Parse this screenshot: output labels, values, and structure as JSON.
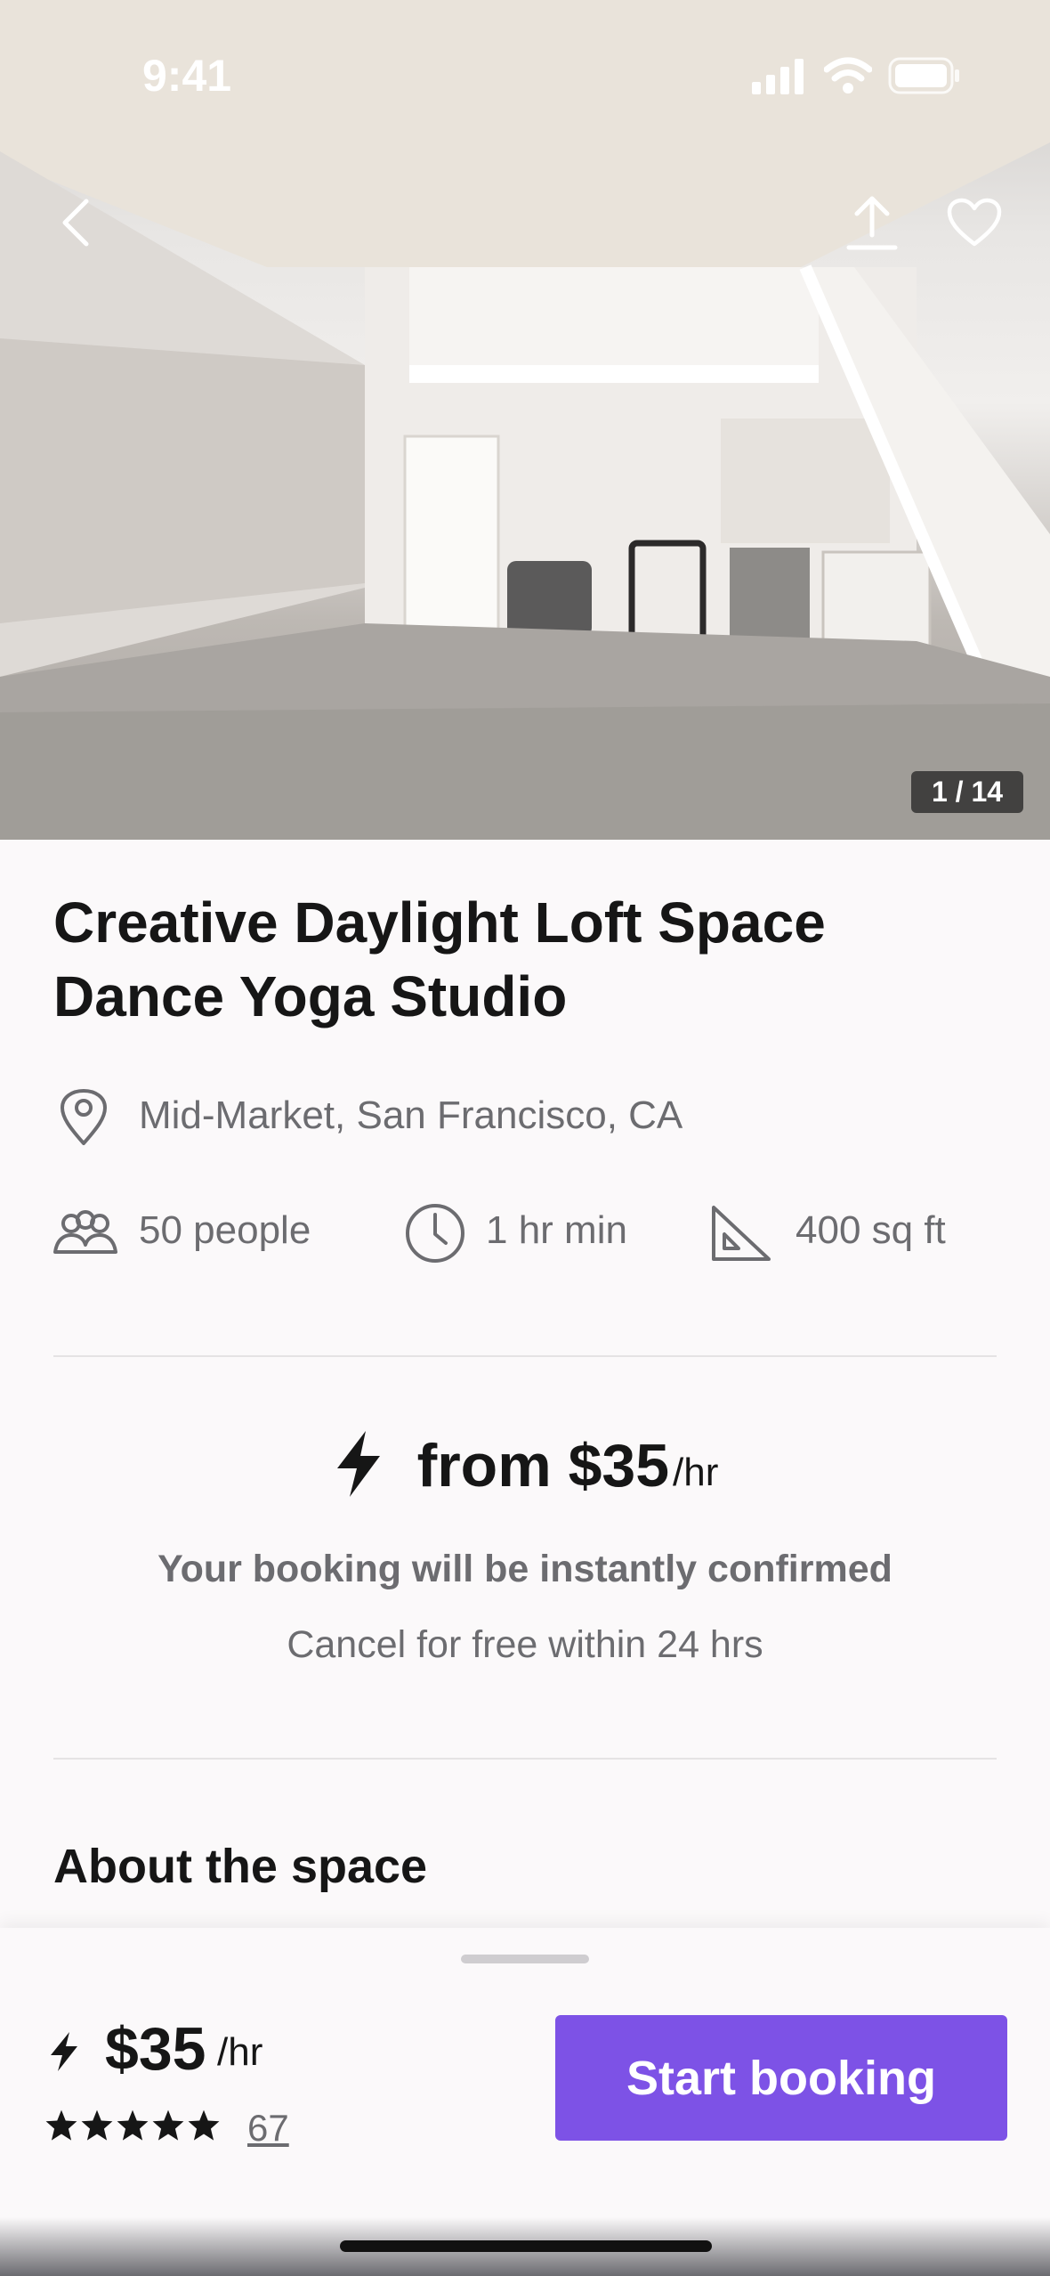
{
  "status_bar": {
    "time": "9:41"
  },
  "hero": {
    "photo_counter": "1 / 14",
    "icons": {
      "back": "chevron-left-icon",
      "share": "share-upload-icon",
      "favorite": "heart-icon"
    }
  },
  "listing": {
    "title": "Creative Daylight Loft Space Dance Yoga Studio",
    "location": "Mid-Market, San Francisco, CA",
    "capacity": "50 people",
    "min_duration": "1 hr min",
    "area": "400 sq ft"
  },
  "pricing": {
    "from_label": "from $35",
    "unit": "/hr",
    "instant_text": "Your booking will be instantly confirmed",
    "cancel_text": "Cancel for free within 24 hrs"
  },
  "about": {
    "heading": "About the space"
  },
  "bottom_sheet": {
    "price": "$35",
    "unit": "/hr",
    "rating_stars": 5,
    "review_count": "67",
    "cta_label": "Start booking"
  },
  "colors": {
    "accent": "#7d52e6",
    "text": "#161616",
    "muted": "#6c6c70"
  }
}
